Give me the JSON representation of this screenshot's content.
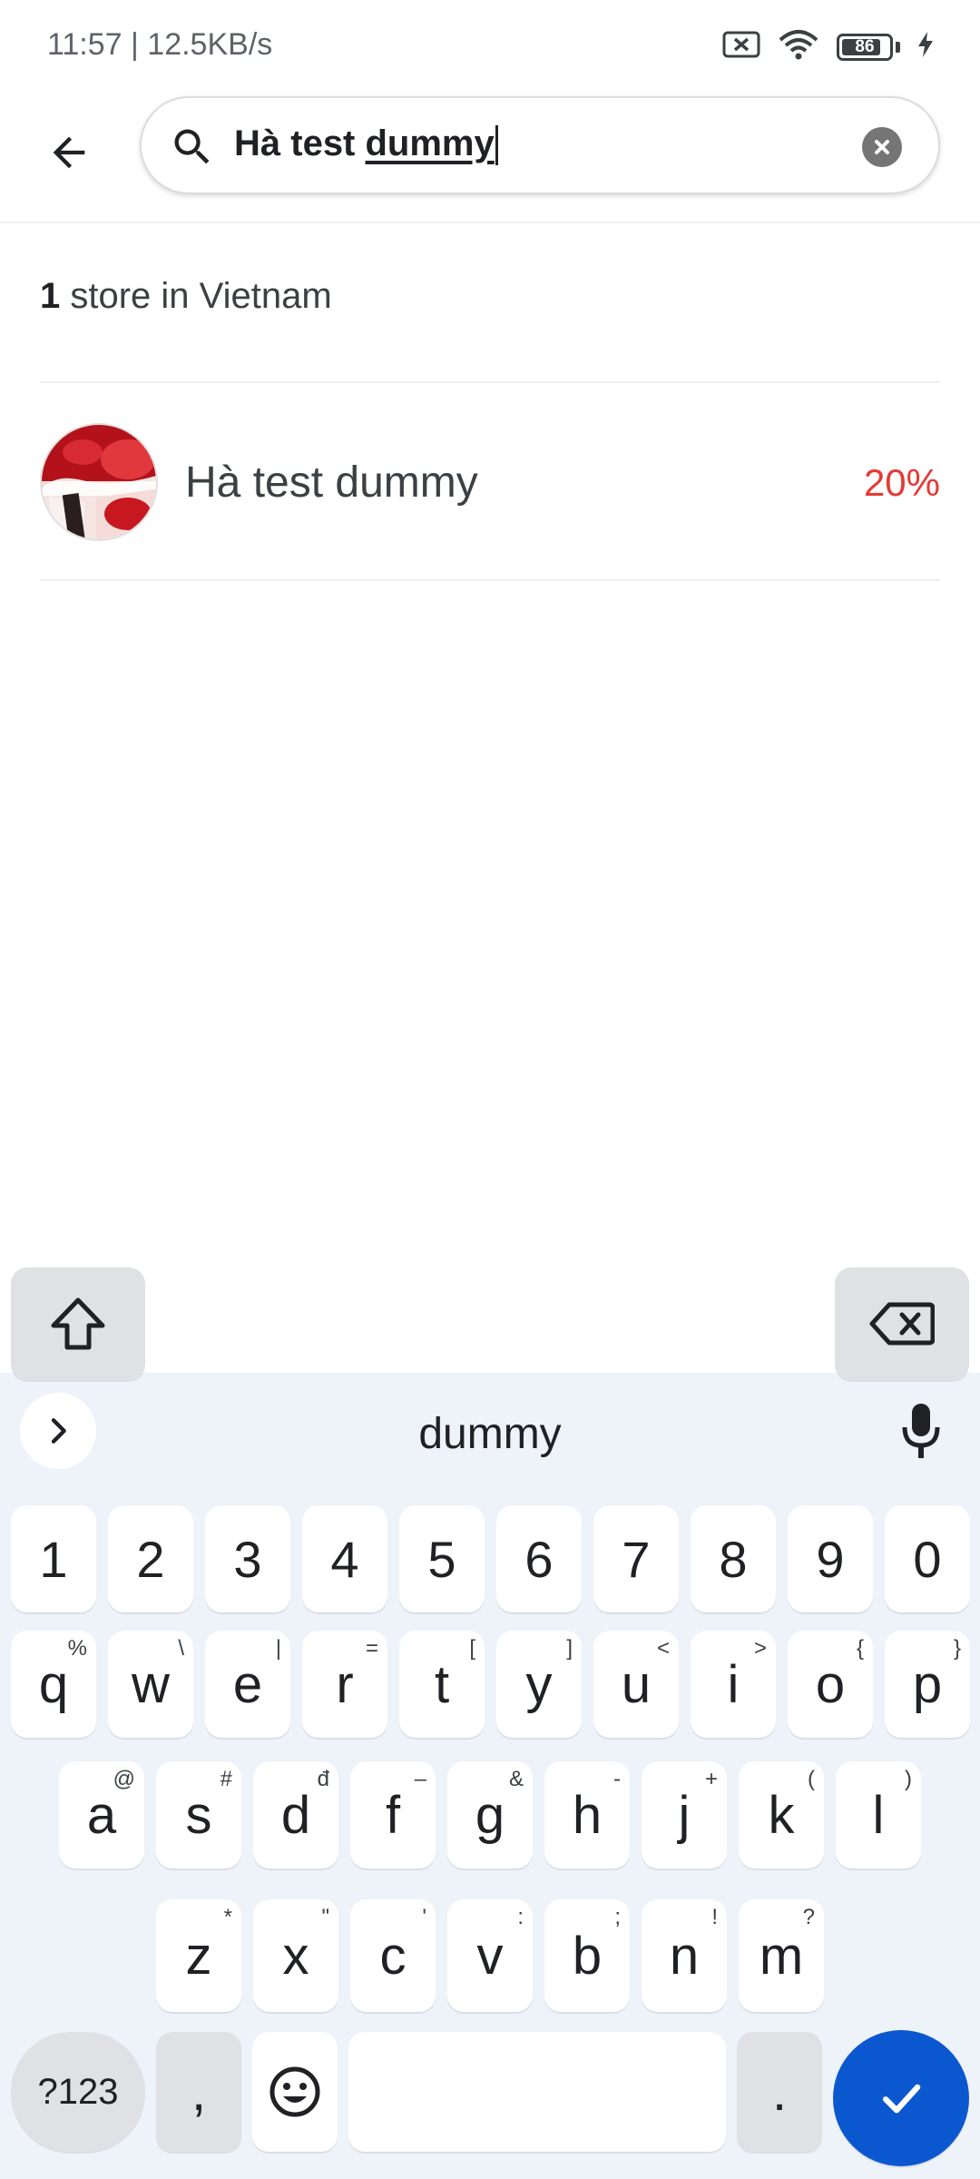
{
  "status_bar": {
    "time_speed": "11:57 | 12.5KB/s",
    "battery": "86",
    "battery_level_percent": 86,
    "icons": [
      "sim-x-icon",
      "wifi-icon",
      "battery-icon",
      "charging-bolt-icon"
    ]
  },
  "search": {
    "query_prefix": "Hà test ",
    "query_word": "dummy"
  },
  "results": {
    "count": "1",
    "count_label": " store in Vietnam",
    "stores": [
      {
        "name": "Hà test dummy",
        "discount": "20%"
      }
    ]
  },
  "keyboard": {
    "suggestion": "dummy",
    "number_row": [
      "1",
      "2",
      "3",
      "4",
      "5",
      "6",
      "7",
      "8",
      "9",
      "0"
    ],
    "row1": [
      {
        "k": "q",
        "h": "%"
      },
      {
        "k": "w",
        "h": "\\"
      },
      {
        "k": "e",
        "h": "|"
      },
      {
        "k": "r",
        "h": "="
      },
      {
        "k": "t",
        "h": "["
      },
      {
        "k": "y",
        "h": "]"
      },
      {
        "k": "u",
        "h": "<"
      },
      {
        "k": "i",
        "h": ">"
      },
      {
        "k": "o",
        "h": "{"
      },
      {
        "k": "p",
        "h": "}"
      }
    ],
    "row2": [
      {
        "k": "a",
        "h": "@"
      },
      {
        "k": "s",
        "h": "#"
      },
      {
        "k": "d",
        "h": "đ"
      },
      {
        "k": "f",
        "h": "–"
      },
      {
        "k": "g",
        "h": "&"
      },
      {
        "k": "h",
        "h": "-"
      },
      {
        "k": "j",
        "h": "+"
      },
      {
        "k": "k",
        "h": "("
      },
      {
        "k": "l",
        "h": ")"
      }
    ],
    "row3": [
      {
        "k": "z",
        "h": "*"
      },
      {
        "k": "x",
        "h": "\""
      },
      {
        "k": "c",
        "h": "'"
      },
      {
        "k": "v",
        "h": ":"
      },
      {
        "k": "b",
        "h": ";"
      },
      {
        "k": "n",
        "h": "!"
      },
      {
        "k": "m",
        "h": "?"
      }
    ],
    "symbols_label": "?123",
    "comma_label": ",",
    "period_label": "."
  },
  "colors": {
    "accent_blue": "#0b57d0",
    "discount_red": "#e53935",
    "keyboard_bg": "#eef2f9"
  }
}
